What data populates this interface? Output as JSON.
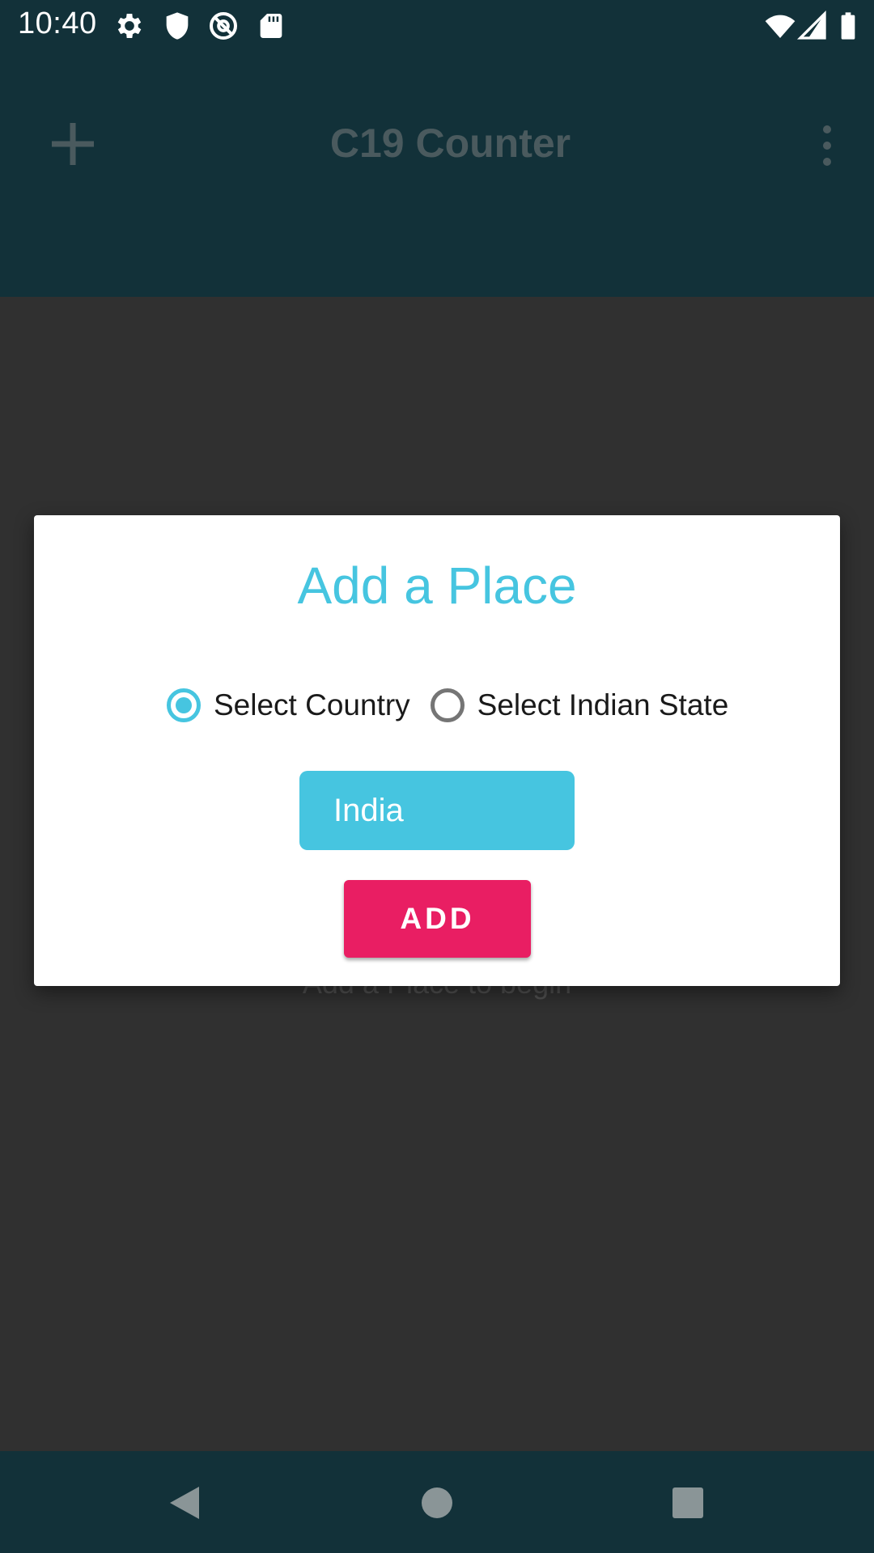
{
  "status_bar": {
    "time": "10:40",
    "icons": [
      "settings-icon",
      "shield-icon",
      "at-sign-icon",
      "sd-card-icon",
      "wifi-icon",
      "signal-icon",
      "battery-icon"
    ]
  },
  "toolbar": {
    "title": "C19 Counter",
    "add_icon": "plus-icon",
    "menu_icon": "more-vert-icon"
  },
  "content": {
    "empty_hint": "Add a Place to begin"
  },
  "dialog": {
    "title": "Add a Place",
    "radio_options": [
      {
        "label": "Select Country",
        "checked": true
      },
      {
        "label": "Select Indian State",
        "checked": false
      }
    ],
    "selected_place": "India",
    "add_button": "ADD"
  },
  "nav_bar": {
    "icons": [
      "back-icon",
      "home-icon",
      "recents-icon"
    ]
  },
  "colors": {
    "accent": "#46c5e0",
    "button": "#e91e63",
    "appbar": "#123139",
    "background": "#303030"
  }
}
